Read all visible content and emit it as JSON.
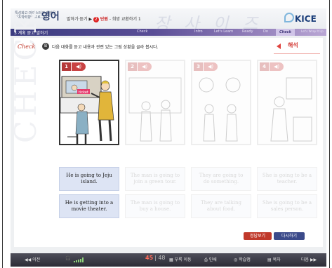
{
  "header": {
    "brand_small": "특성화고·마이스터고 학생용",
    "brand_small2": "기초학력향상프로그램",
    "brand_title": "영어",
    "crumb_section": "말하기·듣기",
    "crumb_unit_num": "2",
    "crumb_unit": "단원",
    "crumb_rest": "- 희망 교환하기 1",
    "decor_text": "장 사 이 즈",
    "logo": "KICE"
  },
  "nav": {
    "title": "3   계획 묻고 말하기",
    "steps": [
      "Check",
      "Intro",
      "Let's Learn",
      "Ready",
      "Do",
      "Check",
      "Let's Wrap It Up"
    ],
    "active_step": "Check"
  },
  "content": {
    "check_label": "Check",
    "question_num": "B",
    "instruction": "다음 대화를 듣고 내용과 관련 있는 그림 상황을 골라 봅시다.",
    "translate_label": "해석",
    "watermark": "CHECK",
    "pictures": [
      {
        "number": "1",
        "active": true
      },
      {
        "number": "2",
        "active": false
      },
      {
        "number": "3",
        "active": false
      },
      {
        "number": "4",
        "active": false
      }
    ],
    "options_row1": [
      "He is going to Jeju island.",
      "The man is going to join a green tour.",
      "They are going to do something.",
      "She is going to be a teacher."
    ],
    "options_row2": [
      "He is getting into a movie theater.",
      "The man is going to buy a house.",
      "They are talking about food.",
      "She is going to be a sales person."
    ],
    "answer_button": "정답보기",
    "retry_button": "다시하기",
    "sign_text": "ticket"
  },
  "footer": {
    "prev": "◀◀ 이전",
    "page_current": "45",
    "page_total": "48",
    "menu_items": [
      "부록 이동",
      "인쇄",
      "학습맵",
      "목차"
    ],
    "next": "다음 ▶▶"
  },
  "colors": {
    "accent_red": "#c0392b",
    "nav_purple": "#4a438a",
    "option_blue": "#dde4f4"
  }
}
